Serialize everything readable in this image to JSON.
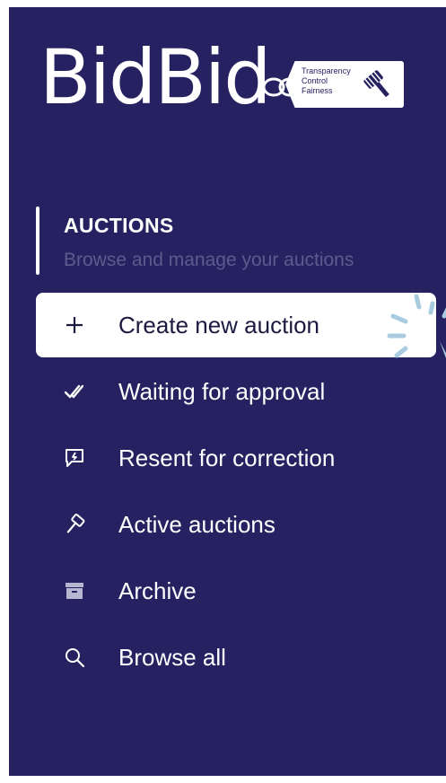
{
  "logo": {
    "wordmark": "BidBid",
    "tag_lines": [
      "Transparency",
      "Control",
      "Fairness"
    ]
  },
  "section": {
    "title": "AUCTIONS",
    "subtitle": "Browse and manage your auctions"
  },
  "menu": [
    {
      "label": "Create new auction",
      "icon": "plus-icon",
      "active": true
    },
    {
      "label": "Waiting for approval",
      "icon": "double-check-icon",
      "active": false
    },
    {
      "label": "Resent for correction",
      "icon": "message-alert-icon",
      "active": false
    },
    {
      "label": "Active auctions",
      "icon": "gavel-icon",
      "active": false
    },
    {
      "label": "Archive",
      "icon": "archive-box-icon",
      "active": false
    },
    {
      "label": "Browse all",
      "icon": "search-icon",
      "active": false
    }
  ],
  "colors": {
    "sidebar_bg": "#262261",
    "active_bg": "#ffffff",
    "text": "#ffffff",
    "subtitle": "#5d5a8e",
    "burst": "#a9cbe0"
  }
}
